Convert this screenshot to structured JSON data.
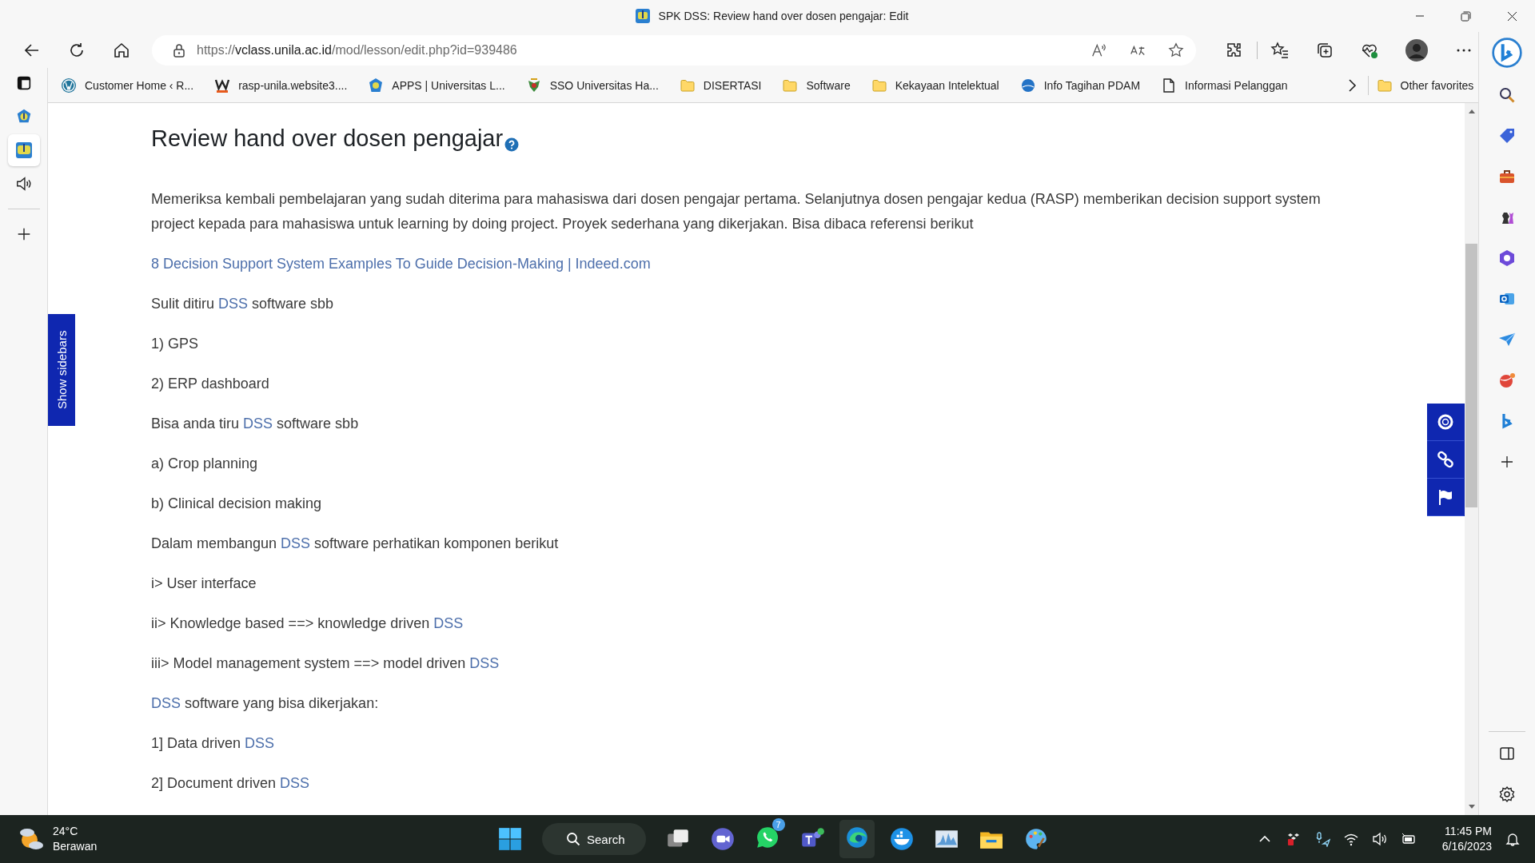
{
  "window": {
    "title": "SPK DSS: Review hand over dosen pengajar: Edit"
  },
  "address": {
    "scheme": "https://",
    "host": "vclass.unila.ac.id",
    "path": "/mod/lesson/edit.php?id=939486"
  },
  "bookmarks": [
    {
      "label": "Customer Home ‹ R...",
      "kind": "wordpress"
    },
    {
      "label": "rasp-unila.website3....",
      "kind": "w"
    },
    {
      "label": "APPS | Universitas L...",
      "kind": "emblem"
    },
    {
      "label": "SSO Universitas Ha...",
      "kind": "crest"
    },
    {
      "label": "DISERTASI",
      "kind": "folder"
    },
    {
      "label": "Software",
      "kind": "folder"
    },
    {
      "label": "Kekayaan Intelektual",
      "kind": "folder"
    },
    {
      "label": "Info Tagihan PDAM",
      "kind": "globe"
    },
    {
      "label": "Informasi Pelanggan",
      "kind": "page"
    }
  ],
  "other_favorites": "Other favorites",
  "lesson": {
    "title": "Review hand over dosen pengajar",
    "paragraphs": [
      {
        "parts": [
          {
            "text": "Memeriksa kembali pembelajaran yang sudah diterima para mahasiswa dari dosen pengajar pertama. Selanjutnya dosen pengajar kedua (RASP) memberikan decision support system project kepada para mahasiswa untuk learning by doing project. Proyek sederhana yang dikerjakan. Bisa dibaca referensi berikut",
            "link": false
          }
        ]
      },
      {
        "parts": [
          {
            "text": "8 Decision Support System Examples To Guide Decision-Making | Indeed.com",
            "link": true
          }
        ]
      },
      {
        "parts": [
          {
            "text": "Sulit ditiru ",
            "link": false
          },
          {
            "text": "DSS",
            "link": true
          },
          {
            "text": " software sbb",
            "link": false
          }
        ]
      },
      {
        "parts": [
          {
            "text": "1) GPS",
            "link": false
          }
        ]
      },
      {
        "parts": [
          {
            "text": "2) ERP dashboard",
            "link": false
          }
        ]
      },
      {
        "parts": [
          {
            "text": "Bisa anda tiru ",
            "link": false
          },
          {
            "text": "DSS",
            "link": true
          },
          {
            "text": " software sbb",
            "link": false
          }
        ]
      },
      {
        "parts": [
          {
            "text": "a) Crop planning",
            "link": false
          }
        ]
      },
      {
        "parts": [
          {
            "text": "b) Clinical decision making",
            "link": false
          }
        ]
      },
      {
        "parts": [
          {
            "text": "Dalam membangun ",
            "link": false
          },
          {
            "text": "DSS",
            "link": true
          },
          {
            "text": " software perhatikan komponen berikut",
            "link": false
          }
        ]
      },
      {
        "parts": [
          {
            "text": "i> User interface",
            "link": false
          }
        ]
      },
      {
        "parts": [
          {
            "text": "ii> Knowledge based ==> knowledge driven ",
            "link": false
          },
          {
            "text": "DSS",
            "link": true
          }
        ]
      },
      {
        "parts": [
          {
            "text": "iii> Model management system ==> model driven ",
            "link": false
          },
          {
            "text": "DSS",
            "link": true
          }
        ]
      },
      {
        "parts": [
          {
            "text": "DSS",
            "link": true
          },
          {
            "text": " software yang bisa dikerjakan:",
            "link": false
          }
        ]
      },
      {
        "parts": [
          {
            "text": "1] Data driven ",
            "link": false
          },
          {
            "text": "DSS",
            "link": true
          }
        ]
      },
      {
        "parts": [
          {
            "text": "2] Document driven ",
            "link": false
          },
          {
            "text": "DSS",
            "link": true
          }
        ]
      }
    ]
  },
  "show_sidebars": "Show sidebars",
  "taskbar": {
    "temperature": "24°C",
    "weather": "Berawan",
    "search": "Search",
    "whatsapp_badge": "7",
    "time": "11:45 PM",
    "date": "6/16/2023"
  }
}
